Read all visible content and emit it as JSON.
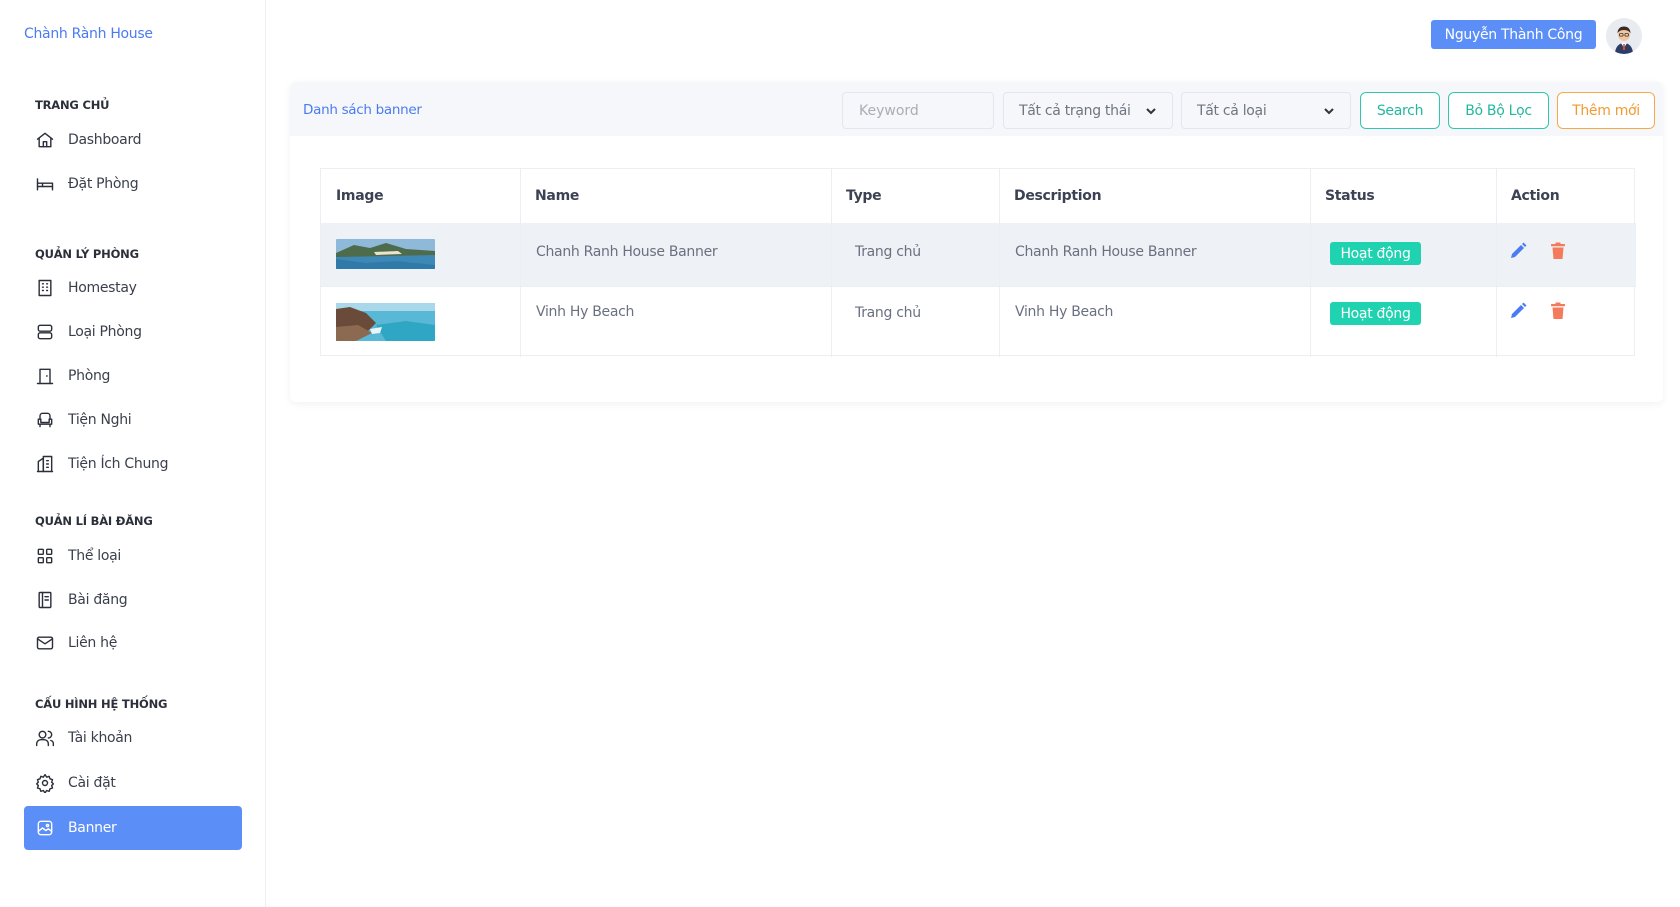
{
  "brand": "Chành Rành House",
  "sidebar": {
    "sections": [
      {
        "title": "TRANG CHỦ"
      },
      {
        "title": "QUẢN LÝ PHÒNG"
      },
      {
        "title": "QUẢN LÍ BÀI ĐĂNG"
      },
      {
        "title": "CẤU HÌNH HỆ THỐNG"
      }
    ],
    "items": [
      {
        "label": "Dashboard",
        "icon": "home-icon"
      },
      {
        "label": "Đặt Phòng",
        "icon": "bed-icon"
      },
      {
        "label": "Homestay",
        "icon": "building-icon"
      },
      {
        "label": "Loại Phòng",
        "icon": "server-icon"
      },
      {
        "label": "Phòng",
        "icon": "door-icon"
      },
      {
        "label": "Tiện Nghi",
        "icon": "armchair-icon"
      },
      {
        "label": "Tiện Ích Chung",
        "icon": "buildings-icon"
      },
      {
        "label": "Thể loại",
        "icon": "grid-icon"
      },
      {
        "label": "Bài đăng",
        "icon": "notebook-icon"
      },
      {
        "label": "Liên hệ",
        "icon": "mail-icon"
      },
      {
        "label": "Tài khoản",
        "icon": "users-icon"
      },
      {
        "label": "Cài đặt",
        "icon": "gear-icon"
      },
      {
        "label": "Banner",
        "icon": "image-icon",
        "active": true
      }
    ]
  },
  "header": {
    "user_name": "Nguyễn Thành Công",
    "avatar_icon": "avatar-icon"
  },
  "toolbar": {
    "title": "Danh sách banner",
    "keyword_placeholder": "Keyword",
    "status_select": "Tất cả trạng thái",
    "type_select": "Tất cả loại",
    "search_label": "Search",
    "clear_label": "Bỏ Bộ Lọc",
    "add_label": "Thêm mới"
  },
  "table": {
    "columns": [
      "Image",
      "Name",
      "Type",
      "Description",
      "Status",
      "Action"
    ],
    "rows": [
      {
        "name": "Chanh Ranh House Banner",
        "type": "Trang chủ",
        "description": "Chanh Ranh House Banner",
        "status": "Hoạt động"
      },
      {
        "name": "Vinh Hy Beach",
        "type": "Trang chủ",
        "description": "Vinh Hy Beach",
        "status": "Hoạt động"
      }
    ]
  },
  "colors": {
    "accent": "#5b8ef7",
    "teal": "#2fc8ae",
    "orange": "#f7a94a",
    "badge": "#1fd3b0",
    "edit": "#4a7bf0",
    "delete": "#f47a5c"
  }
}
